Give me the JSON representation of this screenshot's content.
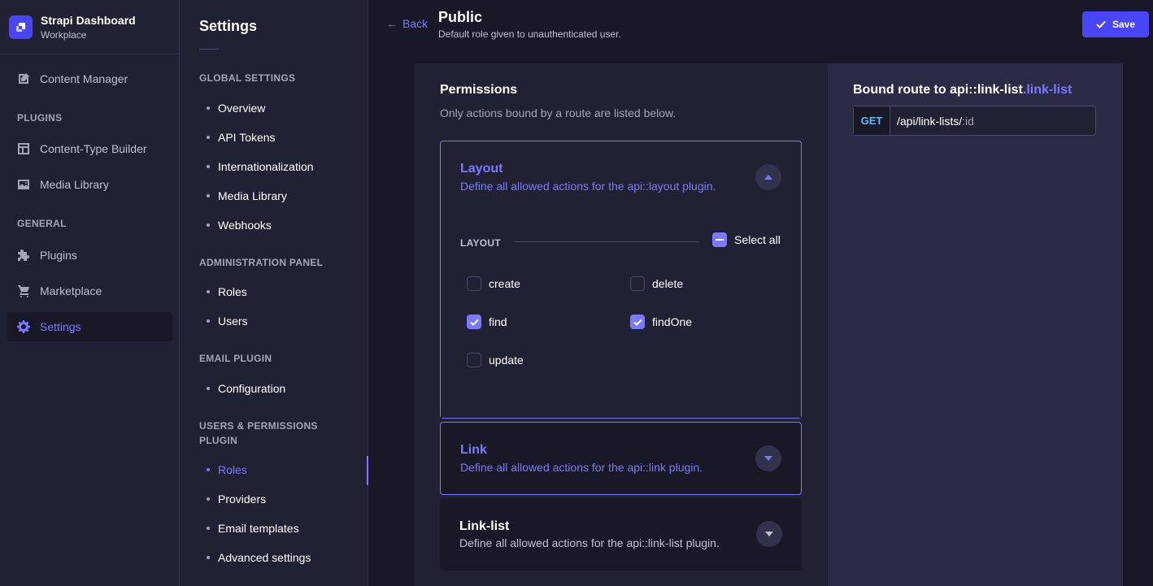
{
  "brand": {
    "title": "Strapi Dashboard",
    "subtitle": "Workplace"
  },
  "mainnav": {
    "content_manager": "Content Manager",
    "plugins_section": "PLUGINS",
    "content_type_builder": "Content-Type Builder",
    "media_library": "Media Library",
    "general_section": "GENERAL",
    "plugins": "Plugins",
    "marketplace": "Marketplace",
    "settings": "Settings"
  },
  "subnav": {
    "title": "Settings",
    "global_section": "GLOBAL SETTINGS",
    "overview": "Overview",
    "api_tokens": "API Tokens",
    "internationalization": "Internationalization",
    "media_library": "Media Library",
    "webhooks": "Webhooks",
    "admin_section": "ADMINISTRATION PANEL",
    "admin_roles": "Roles",
    "admin_users": "Users",
    "email_section": "EMAIL PLUGIN",
    "configuration": "Configuration",
    "up_section": "USERS & PERMISSIONS PLUGIN",
    "up_roles": "Roles",
    "providers": "Providers",
    "email_templates": "Email templates",
    "advanced_settings": "Advanced settings"
  },
  "header": {
    "back": "Back",
    "title": "Public",
    "subtitle": "Default role given to unauthenticated user.",
    "save": "Save"
  },
  "permissions": {
    "title": "Permissions",
    "subtitle": "Only actions bound by a route are listed below.",
    "layout": {
      "title": "Layout",
      "description": "Define all allowed actions for the api::layout plugin.",
      "group_label": "LAYOUT",
      "select_all": "Select all",
      "actions": {
        "create": {
          "label": "create",
          "checked": false
        },
        "delete": {
          "label": "delete",
          "checked": false
        },
        "find": {
          "label": "find",
          "checked": true
        },
        "findOne": {
          "label": "findOne",
          "checked": true
        },
        "update": {
          "label": "update",
          "checked": false
        }
      }
    },
    "link": {
      "title": "Link",
      "description": "Define all allowed actions for the api::link plugin."
    },
    "link_list": {
      "title": "Link-list",
      "description": "Define all allowed actions for the api::link-list plugin."
    }
  },
  "route": {
    "title_prefix": "Bound route to api::link-list",
    "title_highlight": ".link-list",
    "method": "GET",
    "path": "/api/link-lists/",
    "path_param": ":id"
  },
  "colors": {
    "accent": "#7b79ff",
    "primary_button": "#4945ff",
    "method_get": "#66b7f1"
  }
}
